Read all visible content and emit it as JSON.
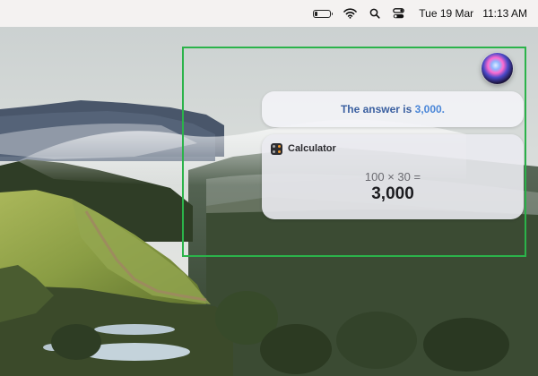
{
  "menubar": {
    "battery_icon": "battery-icon",
    "wifi_icon": "wifi-icon",
    "search_icon": "search-icon",
    "control_center_icon": "control-center-icon",
    "date": "Tue 19 Mar",
    "time": "11:13 AM"
  },
  "siri": {
    "orb_icon": "siri-orb-icon",
    "answer_prefix": "The answer is ",
    "answer_value": "3,000.",
    "answer_color": "#4a86d8"
  },
  "calculator_card": {
    "app_icon": "calculator-icon",
    "title": "Calculator",
    "expression": "100 × 30 =",
    "result": "3,000"
  },
  "highlight": {
    "color": "#2bb34a"
  }
}
